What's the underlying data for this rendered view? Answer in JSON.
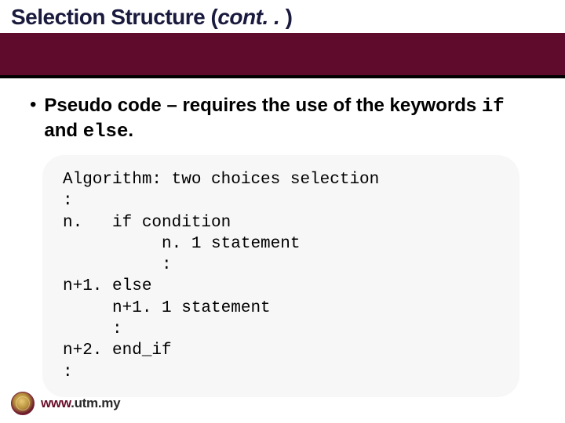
{
  "title": {
    "main": "Selection Structure (",
    "italic": "cont. . ",
    "close": ")"
  },
  "bullet": {
    "marker": "•",
    "prefix": "Pseudo code – requires the use of the keywords ",
    "kw1": "if",
    "mid": " and ",
    "kw2": "else",
    "suffix": "."
  },
  "code": {
    "l1": "Algorithm: two choices selection",
    "l2": ":",
    "l3": "n.   if condition",
    "l4": "          n. 1 statement",
    "l5": "          :",
    "l6": "n+1. else",
    "l7": "     n+1. 1 statement",
    "l8": "     :",
    "l9": "n+2. end_if",
    "l10": ":"
  },
  "footer": {
    "www": "www",
    "rest": ".utm.my"
  }
}
